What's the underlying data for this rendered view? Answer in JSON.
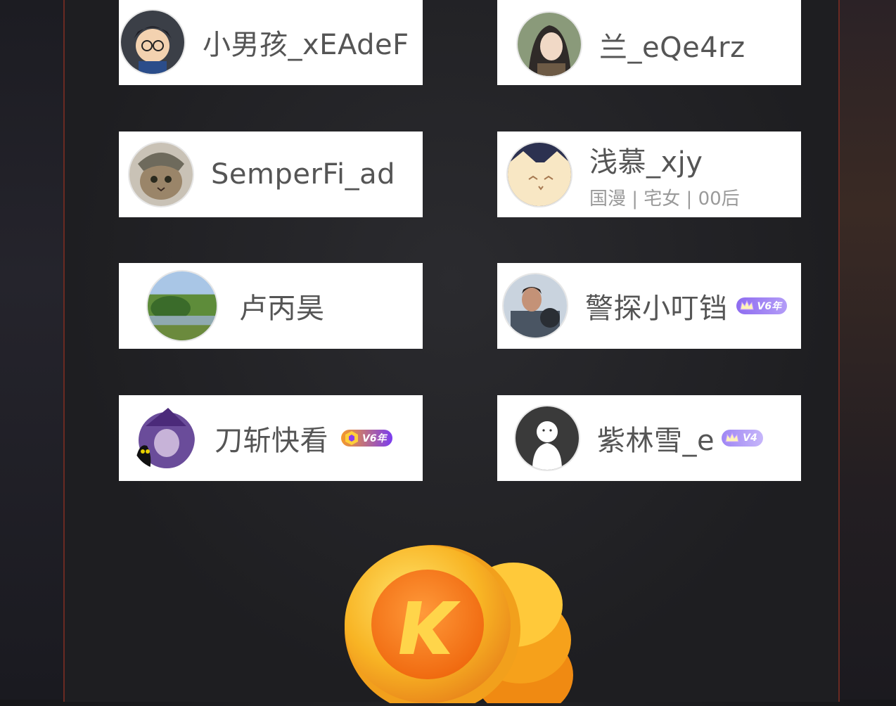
{
  "users": [
    {
      "name": "小男孩_xEAdeF",
      "avatar": "conan-avatar"
    },
    {
      "name": "兰_eQe4rz",
      "avatar": "anime-girl-avatar"
    },
    {
      "name": "SemperFi_ad",
      "avatar": "cat-avatar"
    },
    {
      "name": "浅慕_xjy",
      "tags": "国漫 | 宅女 | 00后",
      "avatar": "cartoon-cat-avatar"
    },
    {
      "name": "卢丙昊",
      "avatar": "landscape-avatar"
    },
    {
      "name": "警探小叮铛",
      "avatar": "pilot-avatar",
      "badge": "V6年"
    },
    {
      "name": "刀斩快看",
      "avatar": "witch-cat-avatar",
      "badge": "V6年"
    },
    {
      "name": "紫林雪_e",
      "avatar": "default-avatar",
      "badge": "V4"
    }
  ],
  "coin_icon": "kk-coin-icon",
  "colors": {
    "panel_border": "#6a2a22",
    "badge_purple": "#8e6cf0",
    "coin": "#f6a11b"
  }
}
